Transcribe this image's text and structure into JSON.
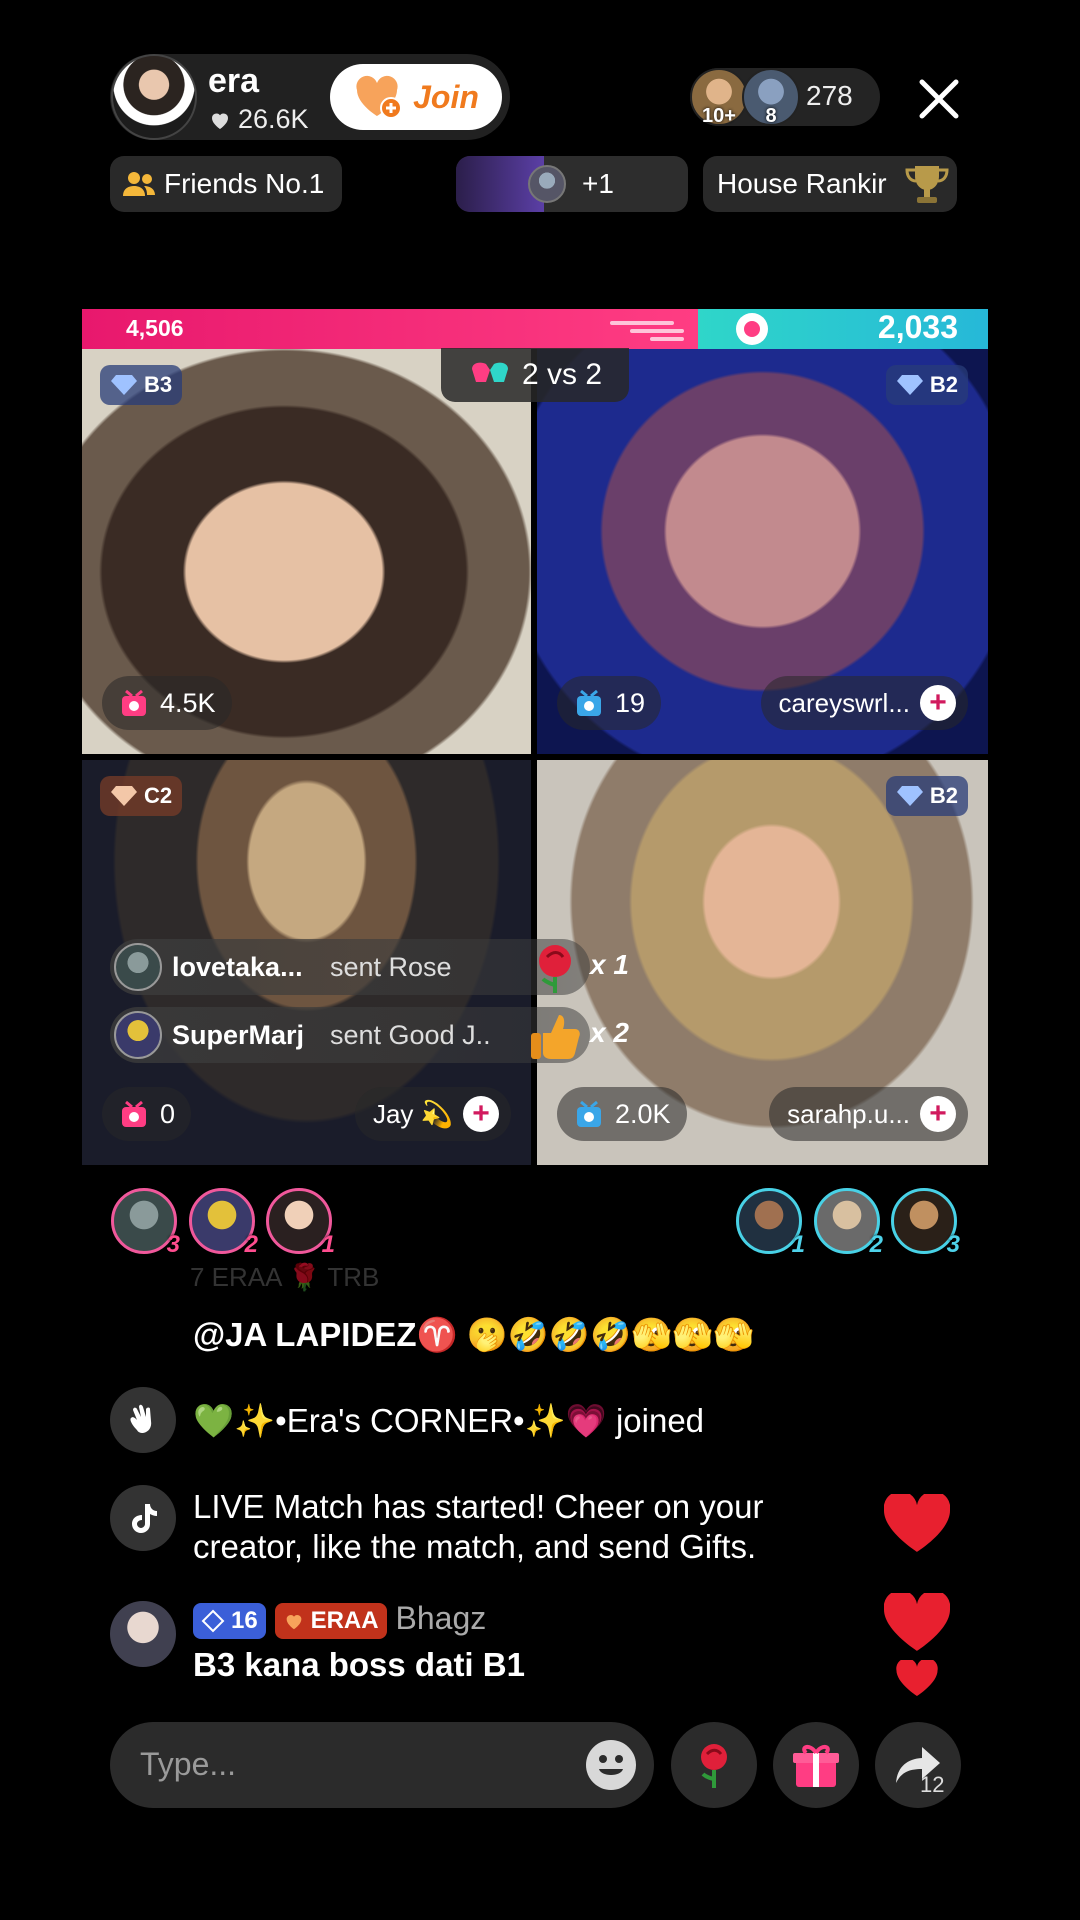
{
  "host": {
    "name": "era",
    "likes": "26.6K",
    "join_label": "Join"
  },
  "viewers": {
    "avatar_badges": [
      "10+",
      "8"
    ],
    "count": "278"
  },
  "chips": {
    "friends": "Friends No.1",
    "plus": "+1",
    "house": "House Rankir"
  },
  "battle": {
    "score_left": "4,506",
    "score_right": "2,033",
    "vs_label": "2 vs 2"
  },
  "tiles": [
    {
      "badge": "B3",
      "score": "4.5K",
      "name": ""
    },
    {
      "badge": "B2",
      "score": "19",
      "name": "careyswrl..."
    },
    {
      "badge": "C2",
      "score": "0",
      "name": "Jay 💫"
    },
    {
      "badge": "B2",
      "score": "2.0K",
      "name": "sarahp.u..."
    }
  ],
  "gifts": [
    {
      "user": "lovetaka...",
      "action": "sent Rose",
      "multiplier": "x 1"
    },
    {
      "user": "SuperMarj",
      "action": "sent Good J...",
      "multiplier": "x 2"
    }
  ],
  "supporters": {
    "left_ranks": [
      "3",
      "2",
      "1"
    ],
    "right_ranks": [
      "1",
      "2",
      "3"
    ]
  },
  "chat": {
    "faded_line": "7  ERAA  🌹 TRB",
    "mention_line": "@JA LAPIDEZ♈️ 🫢🤣🤣🤣🫣🫣🫣",
    "joined_line": "💚✨•Era's CORNER•✨💗 joined",
    "system_line_1": "LIVE Match has started! Cheer on your",
    "system_line_2": "creator, like the match, and send Gifts.",
    "user_level": "16",
    "user_fan_badge": "ERAA",
    "user_name": "Bhagz",
    "user_message": "B3 kana boss dati B1"
  },
  "input": {
    "placeholder": "Type...",
    "share_count": "12"
  },
  "colors": {
    "pink": "#e8186d",
    "teal": "#2fd6c9",
    "join": "#f07a1e",
    "heart": "#e8202f"
  }
}
